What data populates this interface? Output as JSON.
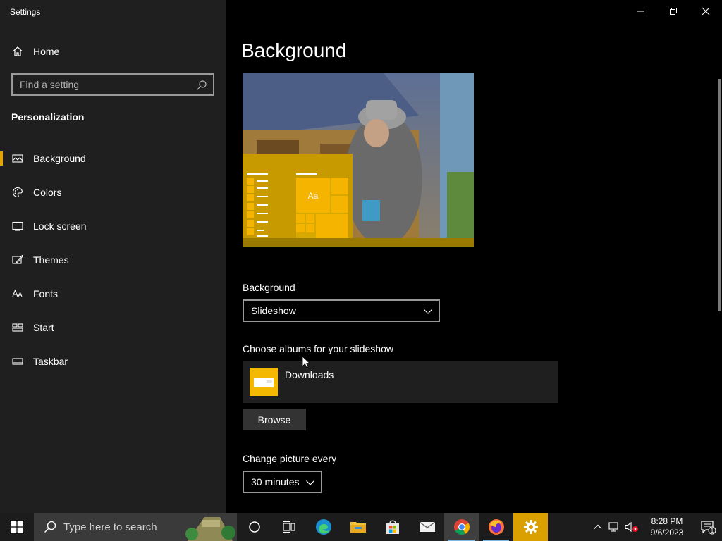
{
  "window": {
    "app_title": "Settings"
  },
  "sidebar": {
    "home_label": "Home",
    "search_placeholder": "Find a setting",
    "section_title": "Personalization",
    "items": [
      {
        "label": "Background",
        "icon": "picture-icon",
        "selected": true
      },
      {
        "label": "Colors",
        "icon": "palette-icon",
        "selected": false
      },
      {
        "label": "Lock screen",
        "icon": "lock-screen-icon",
        "selected": false
      },
      {
        "label": "Themes",
        "icon": "brush-icon",
        "selected": false
      },
      {
        "label": "Fonts",
        "icon": "font-icon",
        "selected": false
      },
      {
        "label": "Start",
        "icon": "start-layout-icon",
        "selected": false
      },
      {
        "label": "Taskbar",
        "icon": "taskbar-icon",
        "selected": false
      }
    ]
  },
  "main": {
    "title": "Background",
    "preview_tile_text": "Aa",
    "background_label": "Background",
    "background_value": "Slideshow",
    "albums_label": "Choose albums for your slideshow",
    "album_name": "Downloads",
    "browse_label": "Browse",
    "change_every_label": "Change picture every",
    "change_every_value": "30 minutes"
  },
  "taskbar": {
    "search_placeholder": "Type here to search",
    "pinned": [
      "cortana-icon",
      "task-view-icon",
      "edge-icon",
      "file-explorer-icon",
      "store-icon",
      "mail-icon",
      "chrome-icon",
      "firefox-icon",
      "settings-icon"
    ],
    "time": "8:28 PM",
    "date": "9/6/2023",
    "notification_count": "1"
  },
  "colors": {
    "accent": "#e3a505",
    "sidebar_bg": "#1f1f1f",
    "main_bg": "#000000"
  }
}
